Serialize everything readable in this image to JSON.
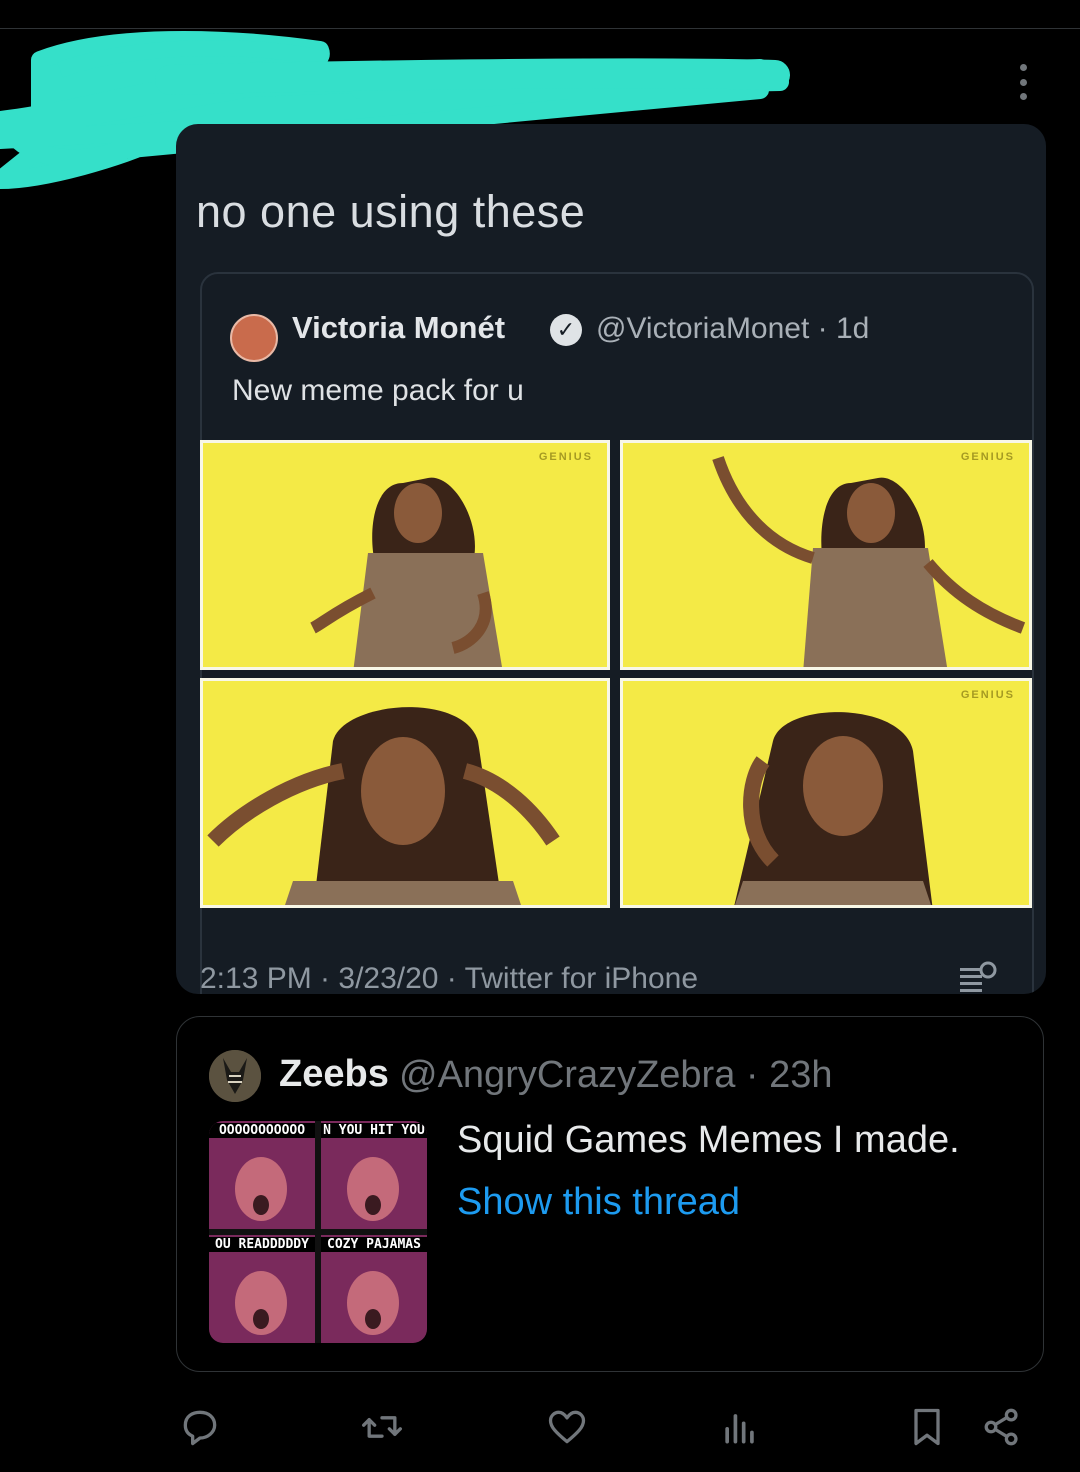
{
  "post": {
    "screenshot": {
      "caption": "no one using these",
      "quoted_tweet": {
        "author_name": "Victoria Monét",
        "verified_mark": "✓",
        "handle_time": "@VictoriaMonet · 1d",
        "text": "New meme pack for u",
        "image_watermark": "GENIUS"
      },
      "footer": "2:13 PM · 3/23/20 · Twitter for iPhone"
    },
    "quoted": {
      "author_name": "Zeebs",
      "handle_time": "@AngryCrazyZebra · 23h",
      "text": "Squid Games Memes I made.",
      "show_thread": "Show this thread",
      "thumbnail_captions": [
        "OOOOOOOOOOO",
        "N YOU HIT YOU",
        "OU READDDDDY",
        "COZY PAJAMAS"
      ]
    }
  },
  "icons": {
    "more": "more-horizontal-icon",
    "reply": "reply-icon",
    "retweet": "retweet-icon",
    "like": "heart-icon",
    "views": "views-icon",
    "bookmark": "bookmark-icon",
    "share": "share-icon"
  },
  "colors": {
    "background": "#000000",
    "accent": "#1d9bf0",
    "muted": "#71767b",
    "scribble": "#35e0c9",
    "meme_yellow": "#f4ea46"
  }
}
